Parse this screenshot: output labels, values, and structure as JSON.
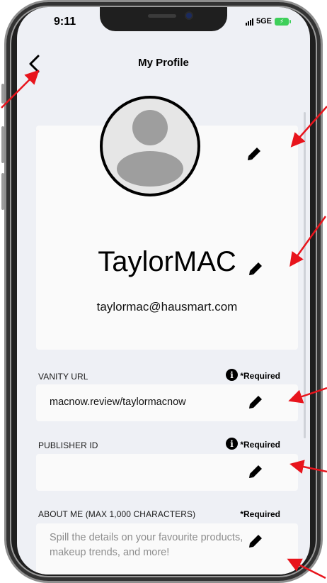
{
  "status_bar": {
    "time": "9:11",
    "network": "5GE",
    "battery_icon": "battery-charging-icon"
  },
  "header": {
    "title": "My Profile",
    "back_icon": "chevron-left-icon"
  },
  "profile": {
    "avatar_icon": "user-placeholder-icon",
    "username": "TaylorMAC",
    "email": "taylormac@hausmart.com",
    "edit_icon": "pencil-icon"
  },
  "fields": {
    "vanity_url": {
      "label": "VANITY URL",
      "required": "*Required",
      "value": "macnow.review/taylormacnow",
      "info_glyph": "i"
    },
    "publisher_id": {
      "label": "PUBLISHER ID",
      "required": "*Required",
      "value": "",
      "info_glyph": "i"
    },
    "about_me": {
      "label": "ABOUT ME (MAX 1,000 CHARACTERS)",
      "required": "*Required",
      "placeholder": "Spill the details on your favourite products, makeup trends, and more!"
    }
  },
  "colors": {
    "screen_bg": "#eef0f5",
    "card_bg": "#fafafa",
    "annotation_arrow": "#e8141c"
  }
}
